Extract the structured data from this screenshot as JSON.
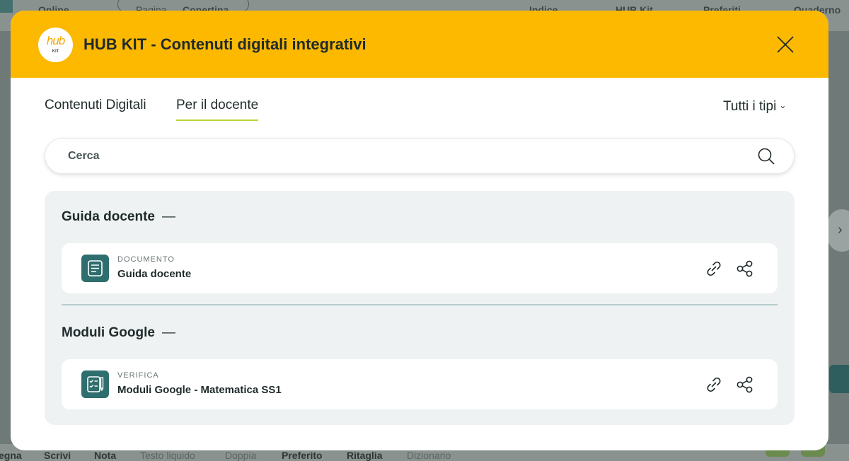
{
  "background": {
    "top_items": [
      "Online",
      "Pagina",
      "Copertina",
      "Indice",
      "HUB Kit",
      "Preferiti",
      "Quaderno"
    ],
    "bottom_items": [
      "egna",
      "Scrivi",
      "Nota",
      "Testo liquido",
      "Doppia",
      "Preferito",
      "Ritaglia",
      "Dizionario"
    ]
  },
  "modal": {
    "logo": {
      "hub": "hub",
      "kit": "KIT"
    },
    "title": "HUB KIT - Contenuti digitali integrativi",
    "tabs": [
      {
        "label": "Contenuti Digitali",
        "active": false
      },
      {
        "label": "Per il docente",
        "active": true
      }
    ],
    "filter": {
      "label": "Tutti i tipi"
    },
    "search": {
      "placeholder": "Cerca",
      "value": ""
    },
    "sections": [
      {
        "title": "Guida docente",
        "items": [
          {
            "type": "DOCUMENTO",
            "name": "Guida docente",
            "icon": "document-icon"
          }
        ]
      },
      {
        "title": "Moduli Google",
        "items": [
          {
            "type": "VERIFICA",
            "name": "Moduli Google - Matematica SS1",
            "icon": "checklist-icon"
          }
        ]
      }
    ]
  },
  "colors": {
    "header": "#fcb900",
    "accent_underline": "#b7d63a",
    "icon_tile": "#2f6e6e",
    "panel": "#eff2f2"
  }
}
